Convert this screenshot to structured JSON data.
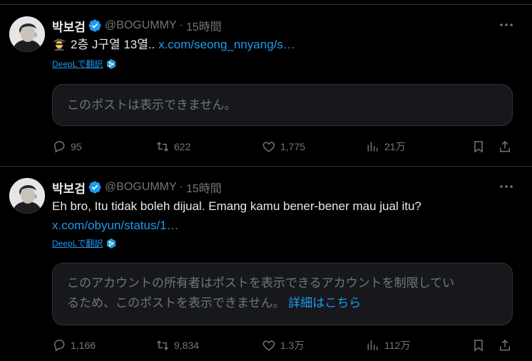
{
  "tweets": [
    {
      "display_name": "박보검",
      "handle": "@BOGUMMY",
      "separator": "·",
      "time": "15時間",
      "text_main": "2층 J구열 13열..",
      "link": "x.com/seong_nnyang/s…",
      "translate_label": "DeepLで翻訳",
      "quote_text": "このポストは表示できません。",
      "stats": {
        "replies": "95",
        "reposts": "622",
        "likes": "1,775",
        "views": "21万"
      }
    },
    {
      "display_name": "박보검",
      "handle": "@BOGUMMY",
      "separator": "·",
      "time": "15時間",
      "text_main": "Eh bro, Itu tidak boleh dijual. Emang kamu bener-bener mau jual itu?",
      "link": "x.com/obyun/status/1…",
      "translate_label": "DeepLで翻訳",
      "quote_text_line1": "このアカウントの所有者はポストを表示できるアカウントを制限してい",
      "quote_text_line2": "るため、このポストを表示できません。",
      "quote_more": "詳細はこちら",
      "stats": {
        "replies": "1,166",
        "reposts": "9,834",
        "likes": "1.3万",
        "views": "112万"
      }
    }
  ],
  "colors": {
    "background": "#000000",
    "text": "#e7e9ea",
    "muted": "#71767b",
    "link": "#1d9bf0",
    "divider": "#2f3336",
    "verified": "#1d9bf0"
  },
  "icons": {
    "verified": "verified-badge-icon",
    "spy": "detective-emoji-icon",
    "more": "more-horizontal-icon",
    "deepl": "deepl-icon",
    "reply": "reply-icon",
    "repost": "repost-icon",
    "like": "heart-icon",
    "views": "views-chart-icon",
    "bookmark": "bookmark-icon",
    "share": "share-icon"
  }
}
